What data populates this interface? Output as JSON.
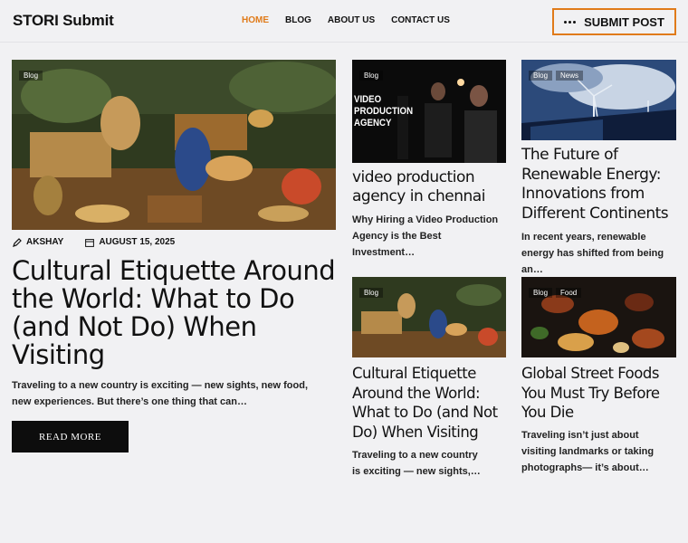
{
  "header": {
    "logo": "STORI Submit",
    "nav": [
      {
        "label": "HOME",
        "active": true
      },
      {
        "label": "BLOG",
        "active": false
      },
      {
        "label": "ABOUT US",
        "active": false
      },
      {
        "label": "CONTACT US",
        "active": false
      }
    ],
    "submit_label": "SUBMIT POST",
    "accent_color": "#e07b1a"
  },
  "featured": {
    "tags": [
      "Blog"
    ],
    "author": "AKSHAY",
    "date": "AUGUST 15, 2025",
    "title": "Cultural Etiquette Around the World: What to Do (and Not Do) When Visiting",
    "excerpt": "Traveling to a new country is exciting — new sights, new food, new experiences. But there’s one thing that can…",
    "read_more": "READ MORE",
    "image_icon": "thai-mural-painting"
  },
  "cards": [
    {
      "tags": [
        "Blog"
      ],
      "image_text": [
        "VIDEO",
        "PRODUCTION",
        "AGENCY"
      ],
      "image_icon": "video-studio-photo",
      "title": "video production agency in chennai",
      "excerpt": "Why Hiring a Video Production Agency is the Best Investment…"
    },
    {
      "tags": [
        "Blog",
        "News"
      ],
      "image_icon": "wind-turbines-solar-photo",
      "title": "The Future of Renewable Energy: Innovations from Different Continents",
      "excerpt": "In recent years, renewable energy has shifted from being an…"
    },
    {
      "tags": [
        "Blog"
      ],
      "image_icon": "thai-mural-painting",
      "title": "Cultural Etiquette Around the World: What to Do (and Not Do) When Visiting",
      "excerpt": "Traveling to a new country is exciting — new sights,…"
    },
    {
      "tags": [
        "Blog",
        "Food"
      ],
      "image_icon": "street-food-photo",
      "title": "Global Street Foods You Must Try Before You Die",
      "excerpt": "Traveling isn’t just about visiting landmarks or taking photographs— it’s about…"
    }
  ]
}
